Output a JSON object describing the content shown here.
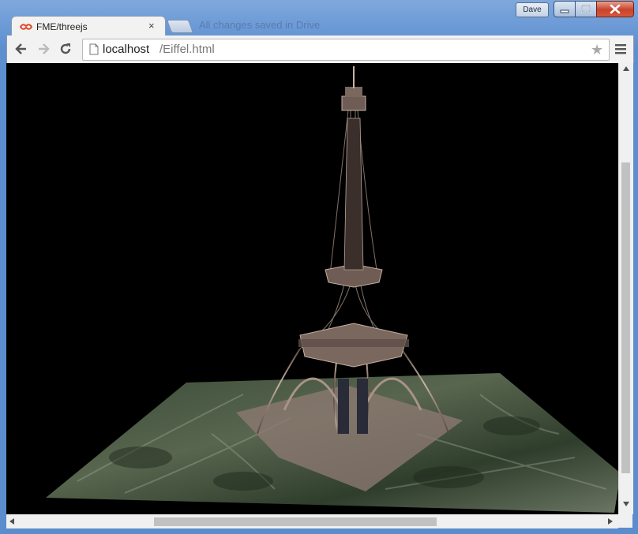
{
  "window": {
    "user_badge": "Dave",
    "background_tab_text": "All changes saved in Drive"
  },
  "tab": {
    "title": "FME/threejs",
    "close_glyph": "×",
    "favicon": "fme-logo-icon"
  },
  "toolbar": {
    "back_icon": "back-arrow-icon",
    "forward_icon": "forward-arrow-icon",
    "reload_icon": "reload-icon",
    "menu_icon": "hamburger-menu-icon"
  },
  "omnibox": {
    "host": "localhost",
    "path": "/Eiffel.html",
    "star_glyph": "★",
    "page_icon": "page-icon"
  },
  "scene": {
    "description_icon": "eiffel-tower-3d-model",
    "background": "#000000"
  },
  "colors": {
    "frame_blue": "#5d8fd0",
    "close_red": "#c8432b",
    "tab_bg": "#f2f2f2"
  }
}
